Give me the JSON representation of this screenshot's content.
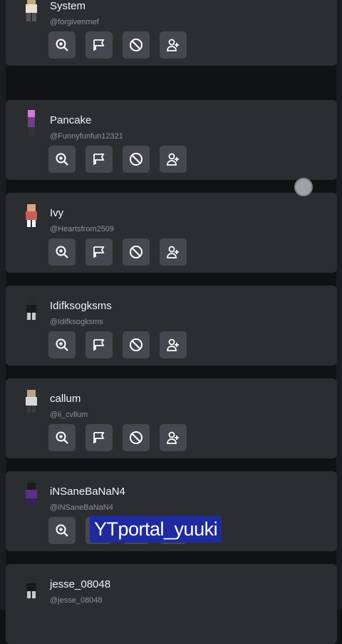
{
  "players": [
    {
      "name": "System",
      "handle": "@forgivenmef",
      "avatar": "avatar-icon"
    },
    {
      "name": "Pancake",
      "handle": "@Funnyfunfun12321",
      "avatar": "avatar-icon"
    },
    {
      "name": "Ivy",
      "handle": "@Heartsfrom2509",
      "avatar": "avatar-icon"
    },
    {
      "name": "Idifksogksms",
      "handle": "@Idifksogksms",
      "avatar": "avatar-icon"
    },
    {
      "name": "callum",
      "handle": "@ii_cvllum",
      "avatar": "avatar-icon"
    },
    {
      "name": "iNSaneBaNaN4",
      "handle": "@iNSaneBaNaN4",
      "avatar": "avatar-icon"
    },
    {
      "name": "jesse_08048",
      "handle": "@jesse_08048",
      "avatar": "avatar-icon"
    }
  ],
  "actions": {
    "inspect_icon": "zoom-in-icon",
    "report_icon": "flag-icon",
    "block_icon": "block-icon",
    "add_friend_icon": "add-friend-icon"
  },
  "watermark": "YTportal_yuuki",
  "colors": {
    "card": "#2b2d31",
    "button": "#45484e",
    "text": "#f2f3f5",
    "handle": "#8e9297",
    "watermark_bg": "#1f2a9e"
  }
}
